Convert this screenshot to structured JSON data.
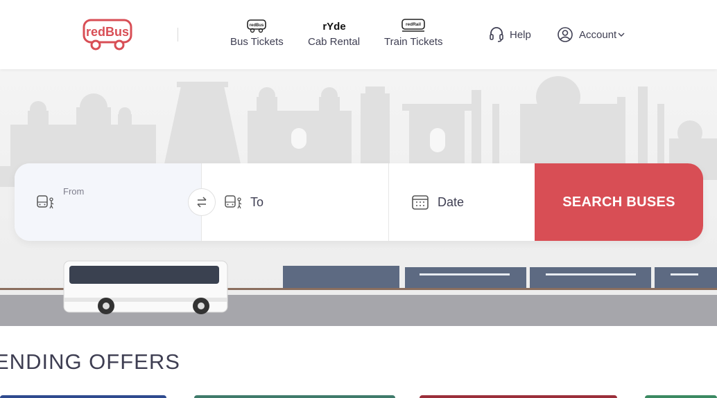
{
  "header": {
    "logo_text": "redBus",
    "nav": [
      {
        "label": "Bus Tickets",
        "icon": "redbus-bus-icon"
      },
      {
        "label": "Cab Rental",
        "icon": "ryde-icon"
      },
      {
        "label": "Train Tickets",
        "icon": "redrail-icon"
      }
    ],
    "help_label": "Help",
    "account_label": "Account"
  },
  "search": {
    "from_label": "From",
    "from_value": "",
    "to_label": "To",
    "date_label": "Date",
    "button_label": "SEARCH BUSES"
  },
  "offers": {
    "title": "ENDING OFFERS"
  },
  "colors": {
    "brand": "#d84e55",
    "text": "#3e3e52",
    "train": "#5d6a82"
  }
}
